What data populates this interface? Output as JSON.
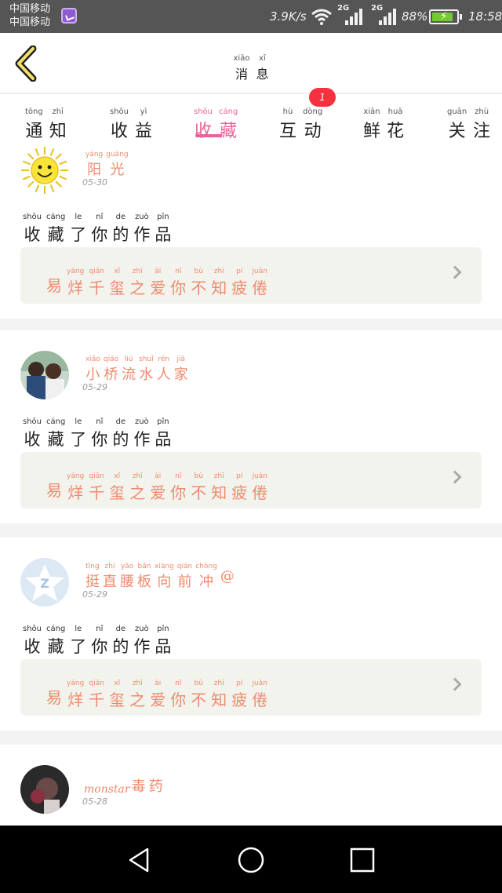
{
  "status_bar": {
    "carrier_1": "中国移动",
    "carrier_2": "中国移动",
    "net_speed": "3.9K/s",
    "network_1": "2G",
    "network_2": "2G",
    "battery_percent": "88%",
    "battery_level": 0.88,
    "time": "18:58",
    "icons": [
      "app-icon",
      "wifi-icon",
      "signal-icon",
      "signal-icon",
      "battery-charging-icon"
    ]
  },
  "header": {
    "title": [
      {
        "hz": "消",
        "py": "xiāo"
      },
      {
        "hz": "息",
        "py": "xī"
      }
    ],
    "back_icon": "chevron-left-icon",
    "accent_color": "#e8639a"
  },
  "tabs": [
    {
      "chars": [
        {
          "hz": "通",
          "py": "tōng"
        },
        {
          "hz": "知",
          "py": "zhī"
        }
      ],
      "active": false
    },
    {
      "chars": [
        {
          "hz": "收",
          "py": "shōu"
        },
        {
          "hz": "益",
          "py": "yì"
        }
      ],
      "active": false
    },
    {
      "chars": [
        {
          "hz": "收",
          "py": "shōu"
        },
        {
          "hz": "藏",
          "py": "cáng"
        }
      ],
      "active": true
    },
    {
      "chars": [
        {
          "hz": "互",
          "py": "hù"
        },
        {
          "hz": "动",
          "py": "dòng"
        }
      ],
      "active": false,
      "badge": "1"
    },
    {
      "chars": [
        {
          "hz": "鲜",
          "py": "xiān"
        },
        {
          "hz": "花",
          "py": "huā"
        }
      ],
      "active": false
    },
    {
      "chars": [
        {
          "hz": "关",
          "py": "guān"
        },
        {
          "hz": "注",
          "py": "zhù"
        }
      ],
      "active": false
    }
  ],
  "feed": [
    {
      "avatar": "sun-avatar",
      "user": [
        {
          "hz": "阳",
          "py": "yáng"
        },
        {
          "hz": "光",
          "py": "guāng"
        }
      ],
      "date": "05-30",
      "action": [
        {
          "hz": "收",
          "py": "shōu"
        },
        {
          "hz": "藏",
          "py": "cáng"
        },
        {
          "hz": "了",
          "py": "le"
        },
        {
          "hz": "你",
          "py": "nǐ"
        },
        {
          "hz": "的",
          "py": "de"
        },
        {
          "hz": "作",
          "py": "zuò"
        },
        {
          "hz": "品",
          "py": "pǐn"
        }
      ],
      "work": [
        {
          "hz": "易",
          "py": ""
        },
        {
          "hz": "烊",
          "py": "yáng"
        },
        {
          "hz": "千",
          "py": "qiān"
        },
        {
          "hz": "玺",
          "py": "xǐ"
        },
        {
          "hz": "之",
          "py": "zhī"
        },
        {
          "hz": "爱",
          "py": "ài"
        },
        {
          "hz": "你",
          "py": "nǐ"
        },
        {
          "hz": "不",
          "py": "bù"
        },
        {
          "hz": "知",
          "py": "zhī"
        },
        {
          "hz": "疲",
          "py": "pí"
        },
        {
          "hz": "倦",
          "py": "juàn"
        }
      ]
    },
    {
      "avatar": "couple-photo-avatar",
      "user": [
        {
          "hz": "小",
          "py": "xiǎo"
        },
        {
          "hz": "桥",
          "py": "qiáo"
        },
        {
          "hz": "流",
          "py": "liú"
        },
        {
          "hz": "水",
          "py": "shuǐ"
        },
        {
          "hz": "人",
          "py": "rén"
        },
        {
          "hz": "家",
          "py": "jiā"
        }
      ],
      "date": "05-29",
      "action": [
        {
          "hz": "收",
          "py": "shōu"
        },
        {
          "hz": "藏",
          "py": "cáng"
        },
        {
          "hz": "了",
          "py": "le"
        },
        {
          "hz": "你",
          "py": "nǐ"
        },
        {
          "hz": "的",
          "py": "de"
        },
        {
          "hz": "作",
          "py": "zuò"
        },
        {
          "hz": "品",
          "py": "pǐn"
        }
      ],
      "work": [
        {
          "hz": "易",
          "py": ""
        },
        {
          "hz": "烊",
          "py": "yáng"
        },
        {
          "hz": "千",
          "py": "qiān"
        },
        {
          "hz": "玺",
          "py": "xǐ"
        },
        {
          "hz": "之",
          "py": "zhī"
        },
        {
          "hz": "爱",
          "py": "ài"
        },
        {
          "hz": "你",
          "py": "nǐ"
        },
        {
          "hz": "不",
          "py": "bù"
        },
        {
          "hz": "知",
          "py": "zhī"
        },
        {
          "hz": "疲",
          "py": "pí"
        },
        {
          "hz": "倦",
          "py": "juàn"
        }
      ]
    },
    {
      "avatar": "qzone-avatar",
      "user": [
        {
          "hz": "挺",
          "py": "tǐng"
        },
        {
          "hz": "直",
          "py": "zhí"
        },
        {
          "hz": "腰",
          "py": "yāo"
        },
        {
          "hz": "板",
          "py": "bǎn"
        },
        {
          "hz": "向",
          "py": "xiàng"
        },
        {
          "hz": "前",
          "py": "qián"
        },
        {
          "hz": "冲",
          "py": "chōng"
        },
        {
          "hz": "@",
          "py": ""
        }
      ],
      "date": "05-29",
      "action": [
        {
          "hz": "收",
          "py": "shōu"
        },
        {
          "hz": "藏",
          "py": "cáng"
        },
        {
          "hz": "了",
          "py": "le"
        },
        {
          "hz": "你",
          "py": "nǐ"
        },
        {
          "hz": "的",
          "py": "de"
        },
        {
          "hz": "作",
          "py": "zuò"
        },
        {
          "hz": "品",
          "py": "pǐn"
        }
      ],
      "work": [
        {
          "hz": "易",
          "py": ""
        },
        {
          "hz": "烊",
          "py": "yáng"
        },
        {
          "hz": "千",
          "py": "qiān"
        },
        {
          "hz": "玺",
          "py": "xǐ"
        },
        {
          "hz": "之",
          "py": "zhī"
        },
        {
          "hz": "爱",
          "py": "ài"
        },
        {
          "hz": "你",
          "py": "nǐ"
        },
        {
          "hz": "不",
          "py": "bù"
        },
        {
          "hz": "知",
          "py": "zhī"
        },
        {
          "hz": "疲",
          "py": "pí"
        },
        {
          "hz": "倦",
          "py": "juàn"
        }
      ]
    },
    {
      "avatar": "rose-photo-avatar",
      "user_latin": "monstar",
      "user": [
        {
          "hz": "毒",
          "py": ""
        },
        {
          "hz": "药",
          "py": ""
        }
      ],
      "date": "05-28"
    }
  ],
  "nav_bar": {
    "icons": [
      "back-triangle-icon",
      "home-circle-icon",
      "recents-square-icon"
    ]
  }
}
